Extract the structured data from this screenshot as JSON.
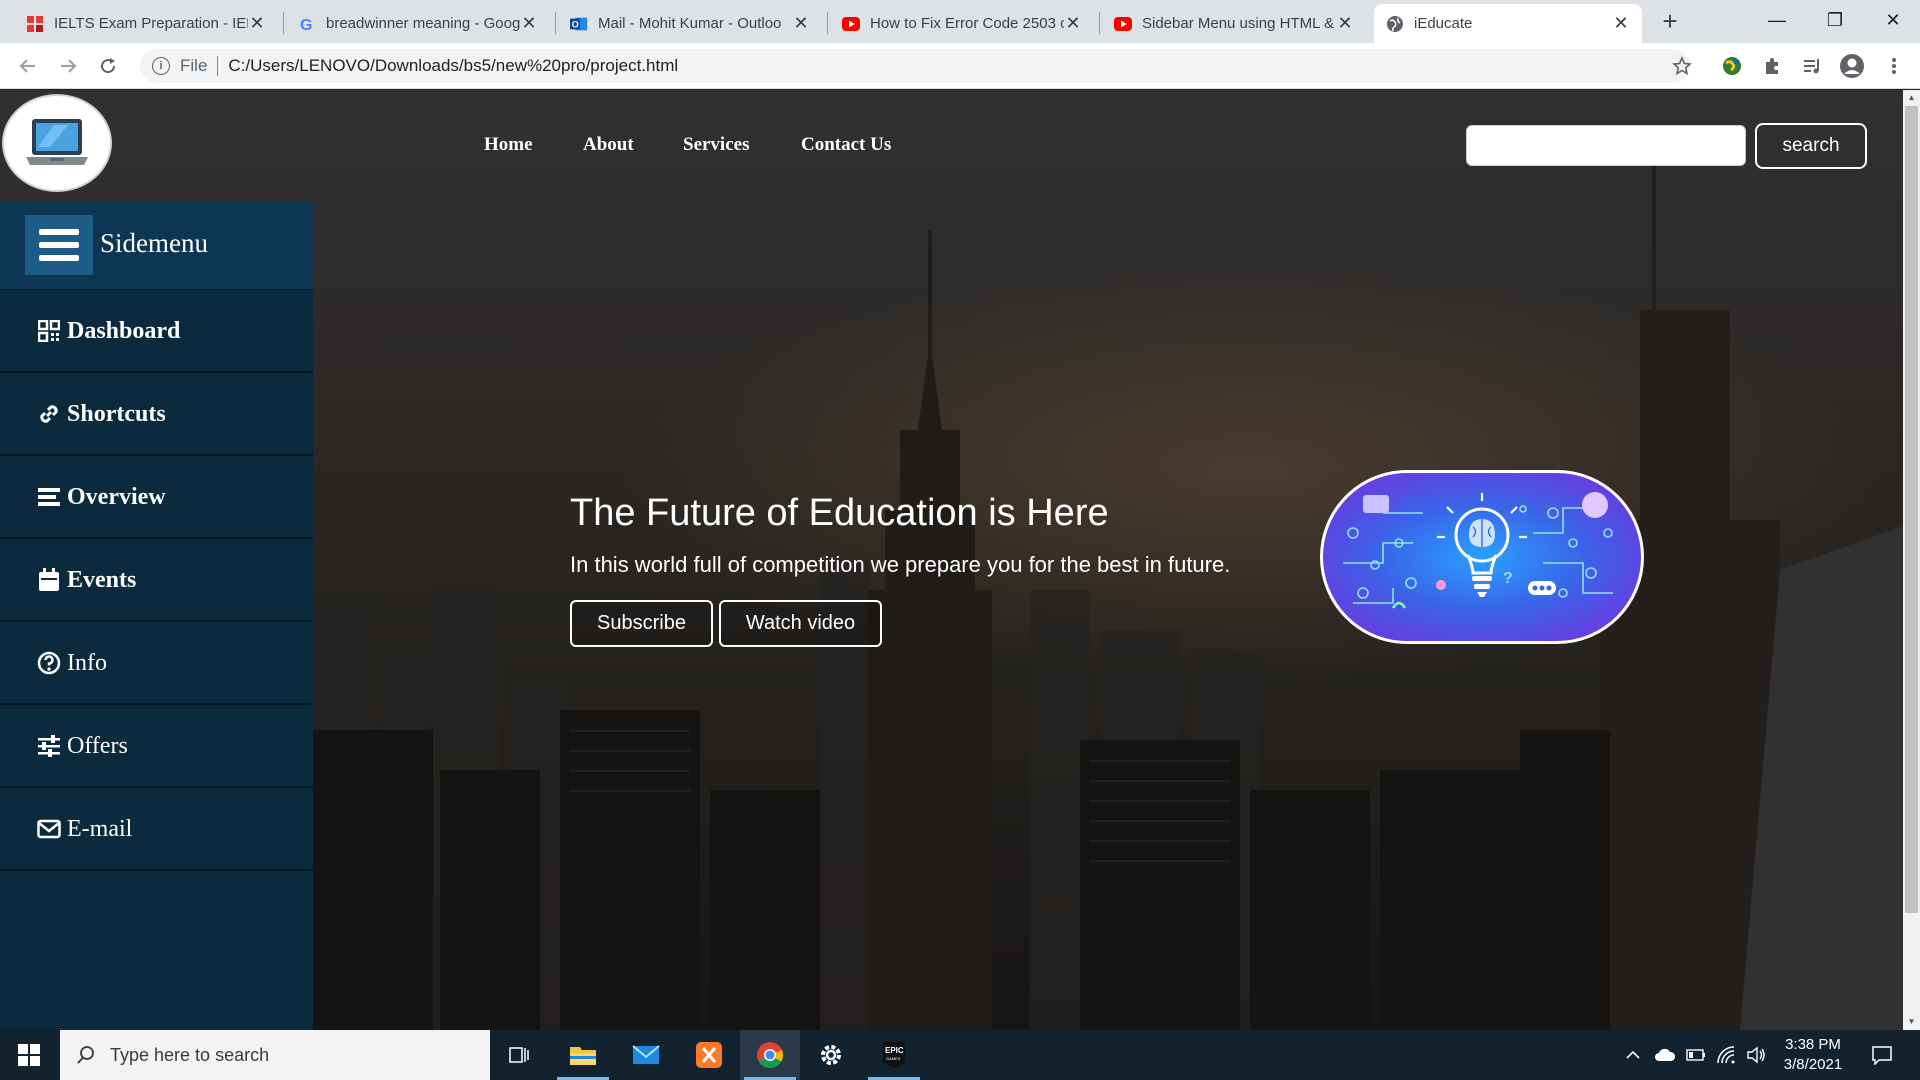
{
  "browser": {
    "tabs": [
      {
        "title": "IELTS Exam Preparation - IELT",
        "icon": "ielts-favicon-icon",
        "active": false
      },
      {
        "title": "breadwinner meaning - Goog",
        "icon": "google-favicon-icon",
        "active": false
      },
      {
        "title": "Mail - Mohit Kumar - Outloo",
        "icon": "outlook-favicon-icon",
        "active": false
      },
      {
        "title": "How to Fix Error Code 2503 o",
        "icon": "youtube-favicon-icon",
        "active": false
      },
      {
        "title": "Sidebar Menu using HTML &",
        "icon": "youtube-favicon-icon",
        "active": false
      },
      {
        "title": "iEducate",
        "icon": "globe-favicon-icon",
        "active": true
      }
    ],
    "address": {
      "scheme_label": "File",
      "url": "C:/Users/LENOVO/Downloads/bs5/new%20pro/project.html"
    }
  },
  "header": {
    "logo_icon": "laptop-icon",
    "nav": [
      "Home",
      "About",
      "Services",
      "Contact Us"
    ],
    "search": {
      "placeholder": "",
      "value": "",
      "button_label": "search"
    }
  },
  "sidebar": {
    "title": "Sidemenu",
    "items": [
      {
        "label": "Dashboard",
        "icon": "dashboard-icon"
      },
      {
        "label": "Shortcuts",
        "icon": "link-icon"
      },
      {
        "label": "Overview",
        "icon": "list-icon"
      },
      {
        "label": "Events",
        "icon": "calendar-icon"
      },
      {
        "label": "Info",
        "icon": "question-circle-icon"
      },
      {
        "label": "Offers",
        "icon": "sliders-icon"
      },
      {
        "label": "E-mail",
        "icon": "envelope-icon"
      }
    ]
  },
  "hero": {
    "title": "The Future of Education is Here",
    "subtitle": "In this world full of competition we prepare you for the best in future.",
    "buttons": [
      "Subscribe",
      "Watch video"
    ],
    "image_icon": "lightbulb-brain-icon"
  },
  "taskbar": {
    "search_placeholder": "Type here to search",
    "time": "3:38 PM",
    "date": "3/8/2021"
  },
  "colors": {
    "sidebar_bg": "#0c2a3d",
    "sidebar_header_bg": "#0d3655",
    "hamburger_bg": "#1c5c86",
    "taskbar_bg": "#12222e"
  }
}
